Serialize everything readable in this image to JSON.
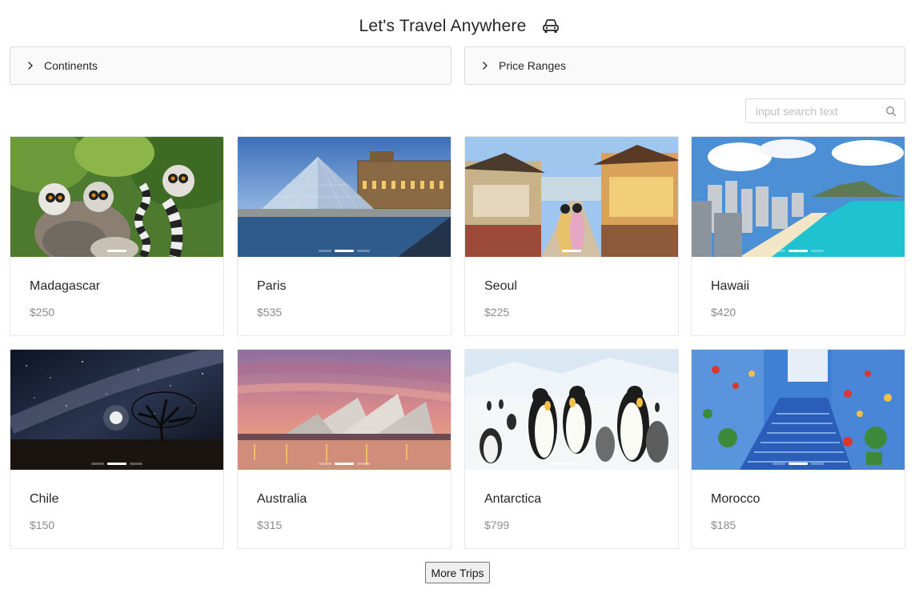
{
  "header": {
    "title": "Let's Travel Anywhere",
    "icon": "car-icon"
  },
  "filters": [
    {
      "label": "Continents",
      "icon": "chevron-right-icon"
    },
    {
      "label": "Price Ranges",
      "icon": "chevron-right-icon"
    }
  ],
  "search": {
    "placeholder": "input search text",
    "value": "",
    "icon": "search-icon"
  },
  "trips": [
    {
      "name": "Madagascar",
      "price": "$250"
    },
    {
      "name": "Paris",
      "price": "$535"
    },
    {
      "name": "Seoul",
      "price": "$225"
    },
    {
      "name": "Hawaii",
      "price": "$420"
    },
    {
      "name": "Chile",
      "price": "$150"
    },
    {
      "name": "Australia",
      "price": "$315"
    },
    {
      "name": "Antarctica",
      "price": "$799"
    },
    {
      "name": "Morocco",
      "price": "$185"
    }
  ],
  "more_button": {
    "label": "More Trips"
  }
}
